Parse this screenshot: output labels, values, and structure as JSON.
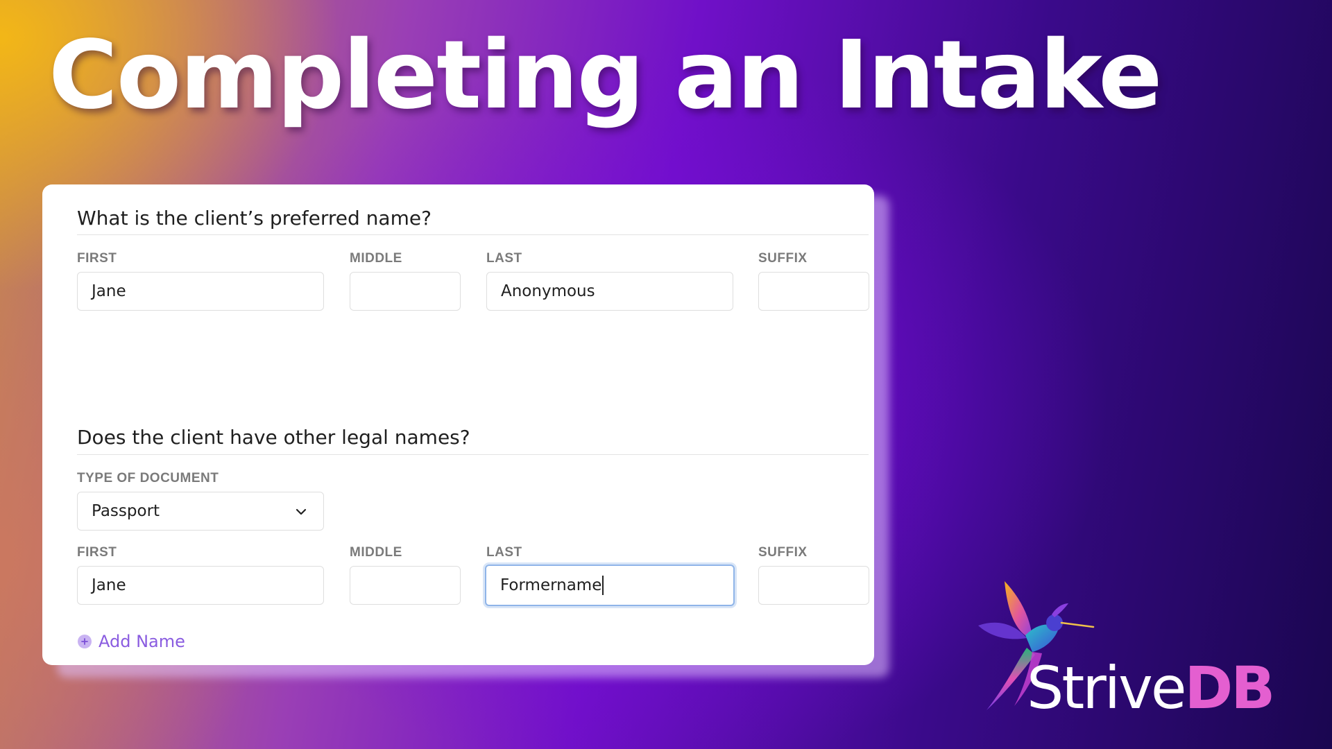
{
  "headline": "Completing an Intake",
  "preferred_name": {
    "question": "What is the client’s preferred name?",
    "labels": {
      "first": "FIRST",
      "middle": "MIDDLE",
      "last": "LAST",
      "suffix": "SUFFIX"
    },
    "values": {
      "first": "Jane",
      "middle": "",
      "last": "Anonymous",
      "suffix": ""
    }
  },
  "legal_names": {
    "question": "Does the client have other legal names?",
    "document_label": "TYPE OF DOCUMENT",
    "document_value": "Passport",
    "labels": {
      "first": "FIRST",
      "middle": "MIDDLE",
      "last": "LAST",
      "suffix": "SUFFIX"
    },
    "values": {
      "first": "Jane",
      "middle": "",
      "last": "Formername",
      "suffix": ""
    },
    "add_label": "Add Name"
  },
  "brand": {
    "part1": "Strive",
    "part2": "DB",
    "accent_color": "#e45fd0"
  },
  "icons": {
    "dropdown": "chevron-down-icon",
    "add": "plus-circle-icon",
    "logo": "hummingbird-logo-icon"
  }
}
